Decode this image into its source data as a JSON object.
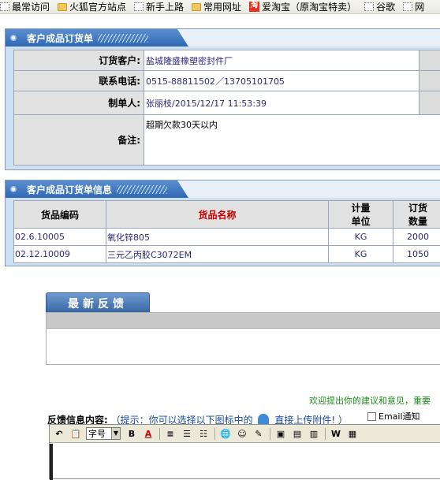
{
  "bookmarks": [
    {
      "label": "最常访问",
      "icon": "dotted-page-icon"
    },
    {
      "label": "火狐官方站点",
      "icon": "folder-icon"
    },
    {
      "label": "新手上路",
      "icon": "dotted-page-icon"
    },
    {
      "label": "常用网址",
      "icon": "folder-icon"
    },
    {
      "label": "爱淘宝（原淘宝特卖）",
      "icon": "taobao-icon"
    },
    {
      "label": "谷歌",
      "icon": "dotted-page-icon"
    },
    {
      "label": "网",
      "icon": "dotted-page-icon"
    }
  ],
  "order": {
    "title": "客户成品订货单",
    "fields": {
      "customer_label": "订货客户:",
      "customer_value": "盐城隆盛橡塑密封件厂",
      "phone_label": "联系电话:",
      "phone_value": "0515-88811502／13705101705",
      "maker_label": "制单人:",
      "maker_value": "张丽枝/2015/12/17 11:53:39",
      "note_label": "备注:",
      "note_value": "超期欠款30天以内"
    }
  },
  "order_items": {
    "title": "客户成品订货单信息",
    "headers": {
      "code": "货品编码",
      "name": "货品名称",
      "unit": "计量单位",
      "qty": "订货数量"
    },
    "rows": [
      {
        "code": "02.6.10005",
        "name": "氧化锌805",
        "unit": "KG",
        "qty": "2000"
      },
      {
        "code": "02.12.10009",
        "name": "三元乙丙胶C3072EM",
        "unit": "KG",
        "qty": "1050"
      }
    ]
  },
  "feedback": {
    "tab_label": "最新反馈",
    "suggest_text": "欢迎提出你的建议和意见，重要",
    "content_label": "反馈信息内容:",
    "hint_prefix": "（提示：你可以选择以下图标中的",
    "hint_link": "直接上传附件!",
    "hint_suffix": "）",
    "email_label": "Email通知",
    "font_size_label": "字号"
  }
}
